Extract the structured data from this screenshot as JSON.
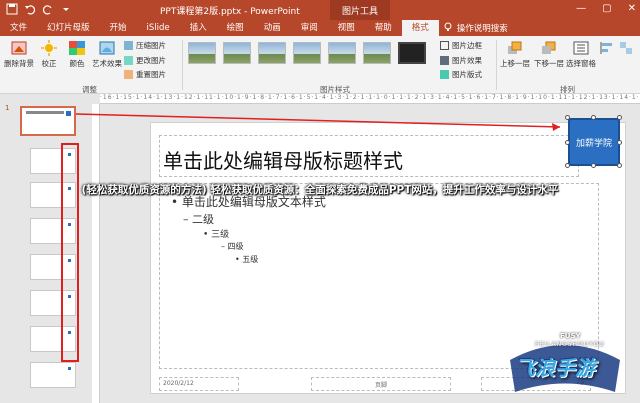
{
  "window": {
    "doc_title": "PPT课程第2版.pptx - PowerPoint",
    "contextual_tab": "图片工具",
    "controls": [
      "—",
      "▢",
      "✕"
    ]
  },
  "tabs": [
    {
      "label": "文件",
      "active": false
    },
    {
      "label": "幻灯片母版",
      "active": false
    },
    {
      "label": "开始",
      "active": false
    },
    {
      "label": "iSlide",
      "active": false
    },
    {
      "label": "插入",
      "active": false
    },
    {
      "label": "绘图",
      "active": false
    },
    {
      "label": "动画",
      "active": false
    },
    {
      "label": "审阅",
      "active": false
    },
    {
      "label": "视图",
      "active": false
    },
    {
      "label": "帮助",
      "active": false
    },
    {
      "label": "格式",
      "active": true
    }
  ],
  "tell_me": "操作说明搜索",
  "ribbon": {
    "adjust": {
      "remove_bg": "删除背景",
      "corrections": "校正",
      "color": "颜色",
      "artistic": "艺术效果",
      "compress": "压缩图片",
      "change": "更改图片",
      "reset": "重置图片",
      "group_label": "调整"
    },
    "styles": {
      "border": "图片边框",
      "effects": "图片效果",
      "layout": "图片版式",
      "group_label": "图片样式"
    },
    "arrange": {
      "bring_forward": "上移一层",
      "send_backward": "下移一层",
      "selection_pane": "选择窗格",
      "group_label": "排列"
    }
  },
  "ruler_text": "·16·1·15·1·14·1·13·1·12·1·11·1·10·1·9·1·8·1·7·1·6·1·5·1·4·1·3·1·2·1·1·1·0·1·1·1·2·1·3·1·4·1·5·1·6·1·7·1·8·1·9·1·10·1·11·1·12·1·13·1·14·1·15·1·16·",
  "thumbnail_pane": {
    "slide_number": "1"
  },
  "slide": {
    "title": "单击此处编辑母版标题样式",
    "body_level1": "• 单击此处编辑母版文本样式",
    "level2": "– 二级",
    "level3": "• 三级",
    "level4": "– 四级",
    "level5": "• 五级",
    "footer_date": "2020/2/12",
    "footer_mid": "页脚",
    "footer_num": "‹#›"
  },
  "logo_text": "加薪学院",
  "overlay_text": "(轻松获取优质资源的方法) 轻松获取优质资源：全面探索免费成品PPT网站，提升工作效率与设计水平",
  "watermark": {
    "top": "FUSY",
    "small": "FEILANGSHOUYOU",
    "big": "飞浪手游"
  },
  "colors": {
    "brand": "#b7472a",
    "accent_blue": "#2b6fc2",
    "highlight_red": "#e02020"
  }
}
